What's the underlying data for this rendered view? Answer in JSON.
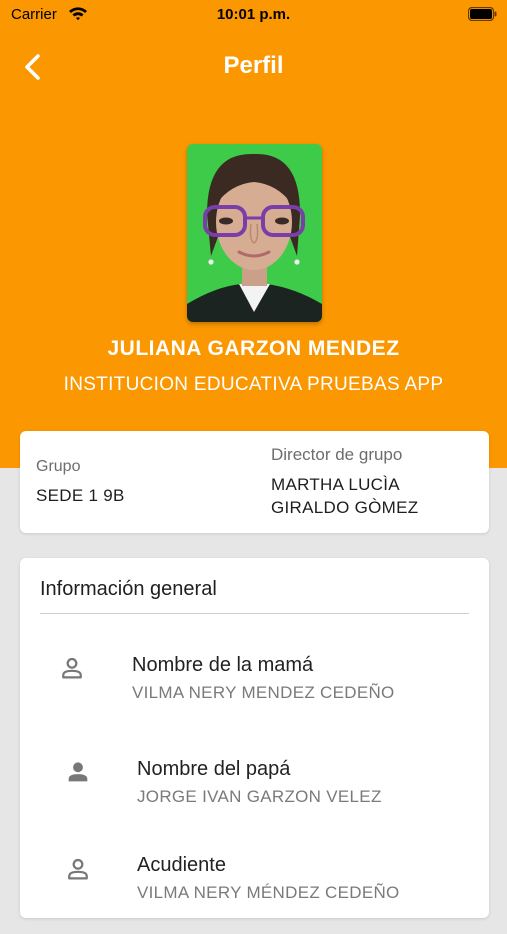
{
  "status_bar": {
    "carrier": "Carrier",
    "time": "10:01 p.m."
  },
  "header": {
    "title": "Perfil",
    "back_icon": "chevron-left-icon"
  },
  "profile": {
    "name": "JULIANA GARZON MENDEZ",
    "school": "INSTITUCION EDUCATIVA PRUEBAS APP"
  },
  "group_card": {
    "group_label": "Grupo",
    "group_value": "SEDE 1 9B",
    "director_label": "Director de grupo",
    "director_line1": "MARTHA LUCÌA",
    "director_line2": "GIRALDO GÒMEZ"
  },
  "general_info": {
    "title": "Información general",
    "rows": [
      {
        "icon": "person-outline-icon",
        "label": "Nombre de la mamá",
        "value": "VILMA NERY MENDEZ CEDEÑO"
      },
      {
        "icon": "person-filled-icon",
        "label": "Nombre del papá",
        "value": "JORGE IVAN GARZON VELEZ"
      },
      {
        "icon": "person-outline-icon",
        "label": "Acudiente",
        "value": "VILMA NERY MÉNDEZ CEDEÑO"
      }
    ]
  },
  "colors": {
    "accent": "#fb9700",
    "background": "#e6e6e6",
    "card": "#ffffff",
    "photo_background": "#3ecb4a"
  }
}
